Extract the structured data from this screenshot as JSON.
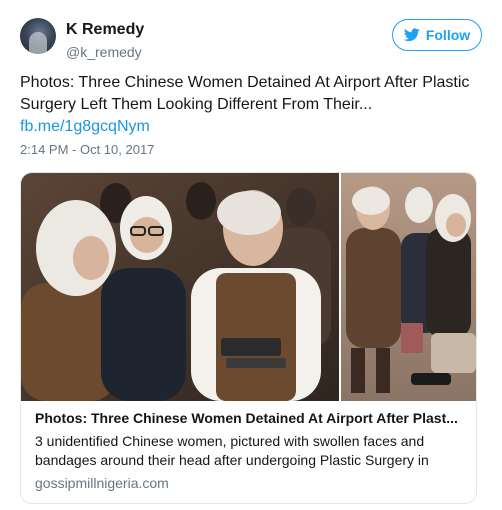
{
  "author": {
    "display_name": "K Remedy",
    "handle": "@k_remedy"
  },
  "follow": {
    "label": "Follow",
    "icon": "twitter-bird-icon",
    "color": "#1da1f2"
  },
  "tweet": {
    "text": "Photos: Three Chinese Women Detained At Airport After Plastic Surgery Left Them Looking Different From Their...",
    "link": "fb.me/1g8gcqNym",
    "timestamp": "2:14 PM - Oct 10, 2017"
  },
  "card": {
    "title": "Photos: Three Chinese Women Detained At Airport After Plast...",
    "description": "3 unidentified Chinese women, pictured with swollen faces and bandages around their head after undergoing Plastic Surgery in",
    "domain": "gossipmillnigeria.com"
  },
  "colors": {
    "link": "#1b95e0",
    "secondary_text": "#657786",
    "border": "#e1e8ed"
  }
}
